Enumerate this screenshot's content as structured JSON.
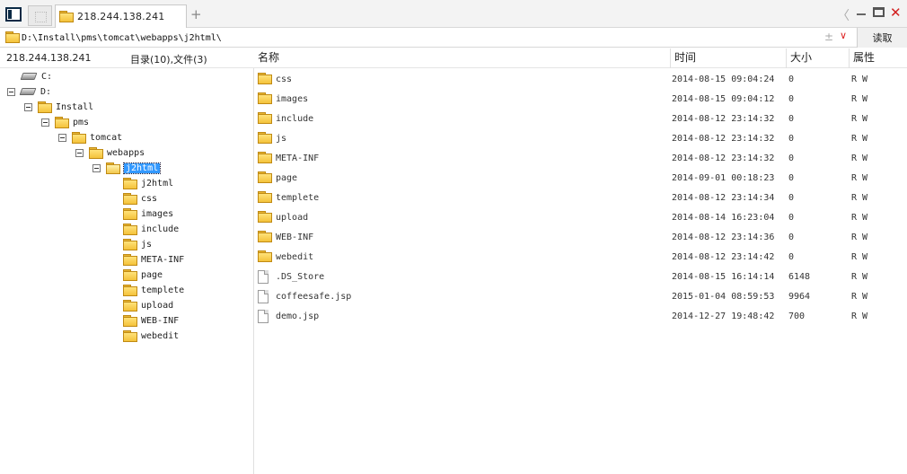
{
  "window": {
    "tab_title": "218.244.138.241",
    "new_tab": "+",
    "back_glyph": "〈",
    "close_glyph": "✕"
  },
  "address": {
    "path": "D:\\Install\\pms\\tomcat\\webapps\\j2html\\",
    "plusminus": "±",
    "dropdown": "∨",
    "read_button": "读取"
  },
  "info": {
    "server": "218.244.138.241",
    "counts": "目录(10),文件(3)"
  },
  "columns": {
    "name": "名称",
    "time": "时间",
    "size": "大小",
    "attr": "属性"
  },
  "tree": {
    "drive_c": "C:",
    "drive_d": "D:",
    "install": "Install",
    "pms": "pms",
    "tomcat": "tomcat",
    "webapps": "webapps",
    "j2html": "j2html",
    "children": [
      "j2html",
      "css",
      "images",
      "include",
      "js",
      "META-INF",
      "page",
      "templete",
      "upload",
      "WEB-INF",
      "webedit"
    ]
  },
  "files": [
    {
      "name": "css",
      "time": "2014-08-15 09:04:24",
      "size": "0",
      "attr": "R W",
      "type": "folder"
    },
    {
      "name": "images",
      "time": "2014-08-15 09:04:12",
      "size": "0",
      "attr": "R W",
      "type": "folder"
    },
    {
      "name": "include",
      "time": "2014-08-12 23:14:32",
      "size": "0",
      "attr": "R W",
      "type": "folder"
    },
    {
      "name": "js",
      "time": "2014-08-12 23:14:32",
      "size": "0",
      "attr": "R W",
      "type": "folder"
    },
    {
      "name": "META-INF",
      "time": "2014-08-12 23:14:32",
      "size": "0",
      "attr": "R W",
      "type": "folder"
    },
    {
      "name": "page",
      "time": "2014-09-01 00:18:23",
      "size": "0",
      "attr": "R W",
      "type": "folder"
    },
    {
      "name": "templete",
      "time": "2014-08-12 23:14:34",
      "size": "0",
      "attr": "R W",
      "type": "folder"
    },
    {
      "name": "upload",
      "time": "2014-08-14 16:23:04",
      "size": "0",
      "attr": "R W",
      "type": "folder"
    },
    {
      "name": "WEB-INF",
      "time": "2014-08-12 23:14:36",
      "size": "0",
      "attr": "R W",
      "type": "folder"
    },
    {
      "name": "webedit",
      "time": "2014-08-12 23:14:42",
      "size": "0",
      "attr": "R W",
      "type": "folder"
    },
    {
      "name": ".DS_Store",
      "time": "2014-08-15 16:14:14",
      "size": "6148",
      "attr": "R W",
      "type": "file"
    },
    {
      "name": "coffeesafe.jsp",
      "time": "2015-01-04 08:59:53",
      "size": "9964",
      "attr": "R W",
      "type": "file"
    },
    {
      "name": "demo.jsp",
      "time": "2014-12-27 19:48:42",
      "size": "700",
      "attr": "R W",
      "type": "file"
    }
  ]
}
